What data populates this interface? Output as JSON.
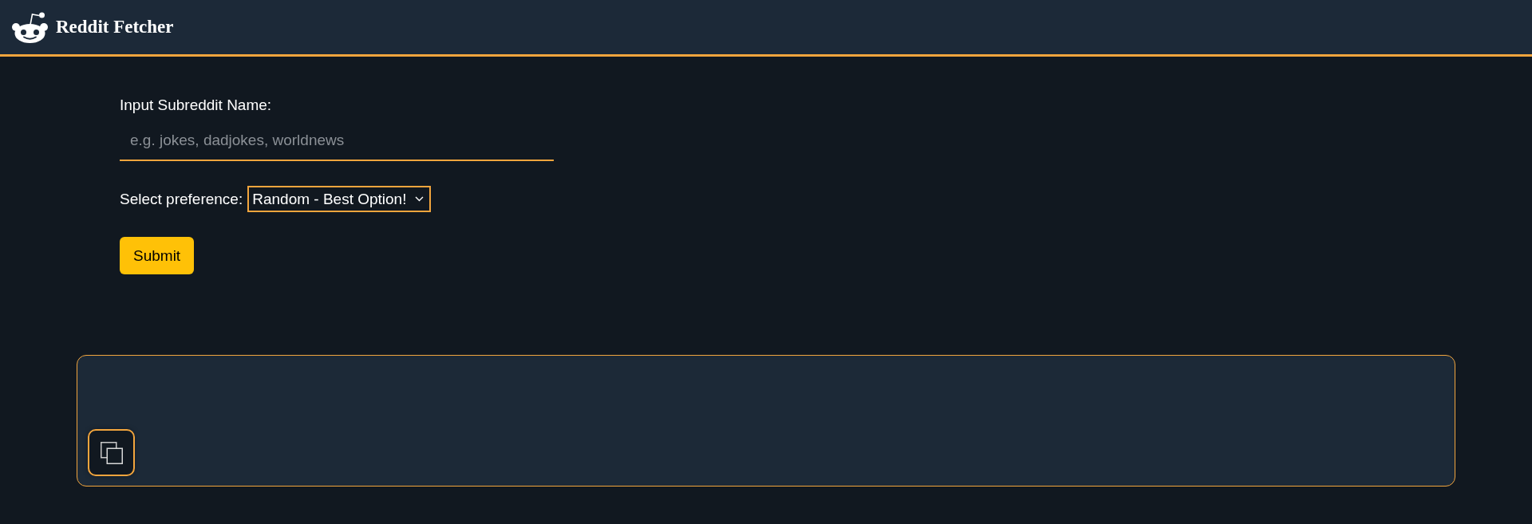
{
  "header": {
    "title": "Reddit Fetcher"
  },
  "form": {
    "subreddit_label": "Input Subreddit Name:",
    "subreddit_input": {
      "placeholder": "e.g. jokes, dadjokes, worldnews"
    },
    "preference_label": "Select preference:",
    "preference_select": {
      "value": "Random - Best Option!"
    },
    "submit_button": "Submit"
  }
}
